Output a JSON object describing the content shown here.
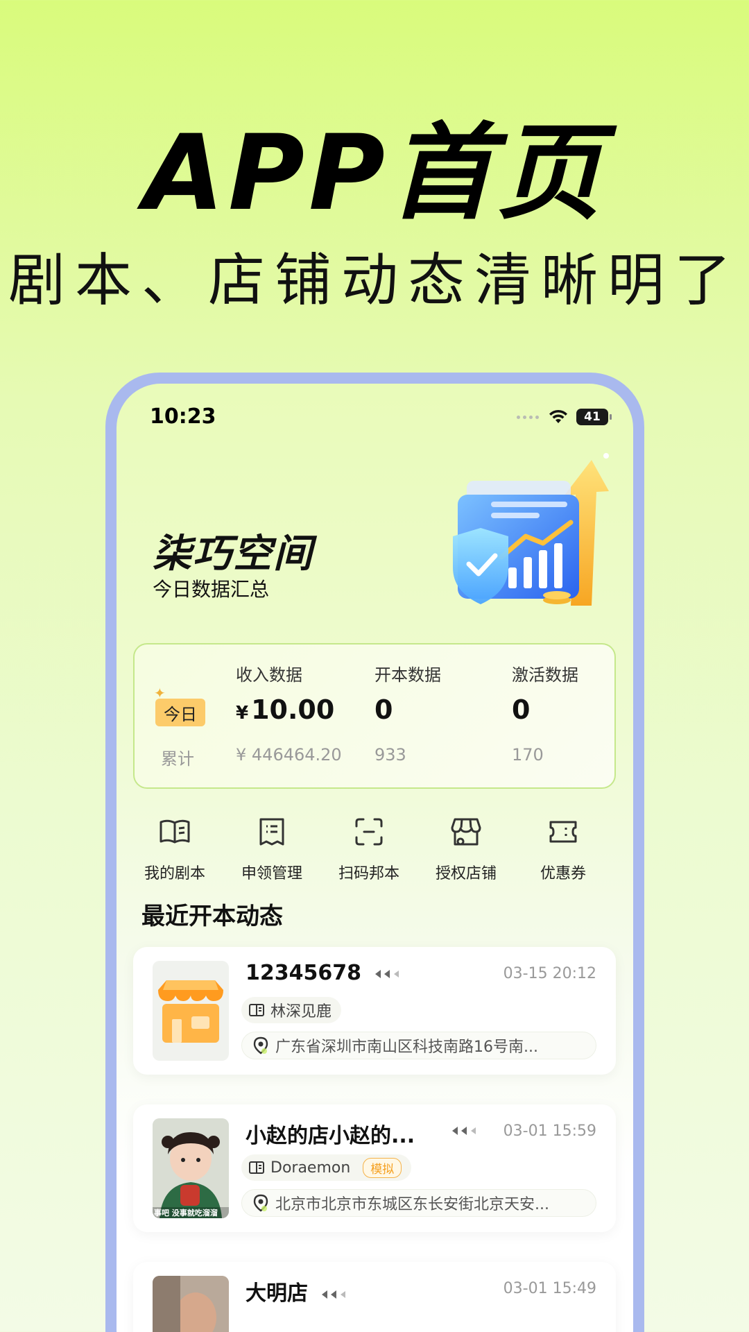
{
  "promo": {
    "title": "APP首页",
    "subtitle": "剧本、店铺动态清晰明了"
  },
  "status_bar": {
    "time": "10:23",
    "battery": "41"
  },
  "header": {
    "brand": "柒巧空间",
    "subtitle": "今日数据汇总"
  },
  "stats": {
    "today_label": "今日",
    "cumulative_label": "累计",
    "columns": [
      {
        "header": "收入数据",
        "currency": "¥",
        "today": "10.00",
        "total": "¥ 446464.20"
      },
      {
        "header": "开本数据",
        "today": "0",
        "total": "933"
      },
      {
        "header": "激活数据",
        "today": "0",
        "total": "170"
      }
    ]
  },
  "quick_actions": [
    {
      "label": "我的剧本",
      "icon": "book-open-icon"
    },
    {
      "label": "申领管理",
      "icon": "document-list-icon"
    },
    {
      "label": "扫码邦本",
      "icon": "scan-icon"
    },
    {
      "label": "授权店铺",
      "icon": "shop-icon"
    },
    {
      "label": "优惠券",
      "icon": "coupon-icon"
    }
  ],
  "section": {
    "title": "最近开本动态"
  },
  "feed": [
    {
      "name": "12345678",
      "time": "03-15 20:12",
      "script": "林深见鹿",
      "address": "广东省深圳市南山区科技南路16号南...",
      "thumb": "shop-thumbnail"
    },
    {
      "name": "小赵的店小赵的...",
      "time": "03-01 15:59",
      "script": "Doraemon",
      "badge": "模拟",
      "address": "北京市北京市东城区东长安街北京天安...",
      "thumb": "child-photo-thumbnail",
      "thumb_caption": "事吧 没事就吃溜溜"
    },
    {
      "name": "大明店",
      "time": "03-01 15:49",
      "thumb": "man-photo-thumbnail"
    }
  ],
  "colors": {
    "background_top": "#d9fb7c",
    "phone_frame": "#a9b9ee",
    "accent_badge": "#fccb6a",
    "card_border": "#c5e88b"
  }
}
